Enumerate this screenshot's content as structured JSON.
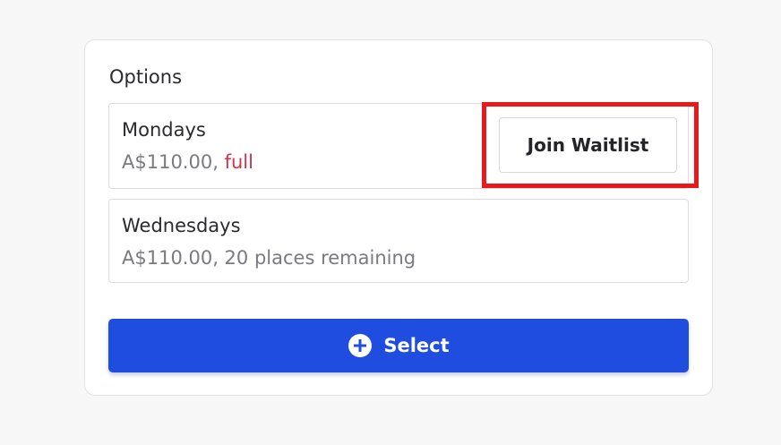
{
  "card": {
    "title": "Options"
  },
  "options": [
    {
      "name": "Mondays",
      "price": "A$110.00,",
      "status": "full",
      "action_label": "Join Waitlist"
    },
    {
      "name": "Wednesdays",
      "details": "A$110.00, 20 places remaining"
    }
  ],
  "select_button": {
    "label": "Select",
    "icon": "plus-circle-icon"
  },
  "colors": {
    "accent": "#1f4de0",
    "full_status": "#d0334a",
    "highlight": "#e8191c"
  }
}
